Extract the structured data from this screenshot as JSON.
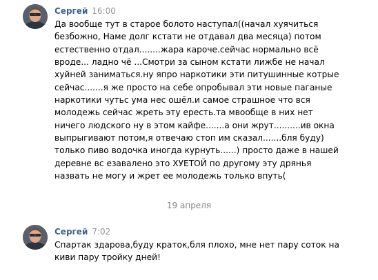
{
  "messages": [
    {
      "author": "Сергей",
      "time": "16:00",
      "lines": [
        "Да вообще тут в старое болото наступал((начал хуячиться",
        "безбожно, Наме долг кстати не отдавал два месяца) потом",
        "естественно отдал........жара кароче.сейчас нормально всё",
        "вроде... ладно чё ...Смотри за сыном кстати лижбе не начал",
        "хуйней заниматься.ну япро наркотики эти питушинные котрые",
        "сейчас.......я же просто на себе опробывал эти новые паганые",
        "наркотики чутьс ума нес ошёл.и самое страшное что вся",
        "молодежь сейчас жреть эту ересть.та мвообще в них нет",
        "ничего людского ну в этом кайфе.......а они жрут..........ив окна",
        "выпрыгивают потом,я отвечаю стоп им сказал.......бля буду)",
        "только пиво водочка иногда курнуть......) просто даже в нашей",
        "деревне вс езавалено это ХУЕТОЙ по другому эту дрянья",
        "назвать не могу и жрет ее молодежь только впуть("
      ]
    },
    {
      "author": "Сергей",
      "time": "7:02",
      "lines": [
        "Спартак здарова,буду краток,бля плохо, мне нет пару соток на",
        "киви пару тройку дней!"
      ]
    }
  ],
  "date_separator": "19 апреля",
  "colors": {
    "author": "#42648b",
    "time": "#939393",
    "text": "#000000",
    "date_separator": "#828282",
    "background": "#ffffff"
  }
}
